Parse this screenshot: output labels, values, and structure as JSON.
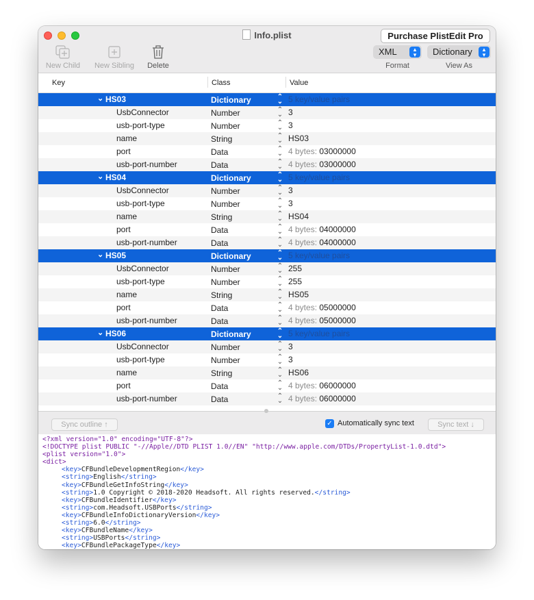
{
  "window": {
    "title": "Info.plist",
    "purchase_label": "Purchase PlistEdit Pro"
  },
  "toolbar": {
    "new_child": "New Child",
    "new_sibling": "New Sibling",
    "delete": "Delete",
    "format_value": "XML",
    "format_label": "Format",
    "view_as_value": "Dictionary",
    "view_as_label": "View As"
  },
  "columns": {
    "key": "Key",
    "class": "Class",
    "value": "Value"
  },
  "rows": [
    {
      "key": "HS03",
      "class": "Dictionary",
      "value": "",
      "hint": "5 key/value pairs",
      "group": true
    },
    {
      "key": "UsbConnector",
      "class": "Number",
      "value": "3",
      "hint": ""
    },
    {
      "key": "usb-port-type",
      "class": "Number",
      "value": "3",
      "hint": ""
    },
    {
      "key": "name",
      "class": "String",
      "value": "HS03",
      "hint": ""
    },
    {
      "key": "port",
      "class": "Data",
      "value": "03000000",
      "hint": "4 bytes:"
    },
    {
      "key": "usb-port-number",
      "class": "Data",
      "value": "03000000",
      "hint": "4 bytes:"
    },
    {
      "key": "HS04",
      "class": "Dictionary",
      "value": "",
      "hint": "5 key/value pairs",
      "group": true
    },
    {
      "key": "UsbConnector",
      "class": "Number",
      "value": "3",
      "hint": ""
    },
    {
      "key": "usb-port-type",
      "class": "Number",
      "value": "3",
      "hint": ""
    },
    {
      "key": "name",
      "class": "String",
      "value": "HS04",
      "hint": ""
    },
    {
      "key": "port",
      "class": "Data",
      "value": "04000000",
      "hint": "4 bytes:"
    },
    {
      "key": "usb-port-number",
      "class": "Data",
      "value": "04000000",
      "hint": "4 bytes:"
    },
    {
      "key": "HS05",
      "class": "Dictionary",
      "value": "",
      "hint": "5 key/value pairs",
      "group": true
    },
    {
      "key": "UsbConnector",
      "class": "Number",
      "value": "255",
      "hint": ""
    },
    {
      "key": "usb-port-type",
      "class": "Number",
      "value": "255",
      "hint": ""
    },
    {
      "key": "name",
      "class": "String",
      "value": "HS05",
      "hint": ""
    },
    {
      "key": "port",
      "class": "Data",
      "value": "05000000",
      "hint": "4 bytes:"
    },
    {
      "key": "usb-port-number",
      "class": "Data",
      "value": "05000000",
      "hint": "4 bytes:"
    },
    {
      "key": "HS06",
      "class": "Dictionary",
      "value": "",
      "hint": "5 key/value pairs",
      "group": true
    },
    {
      "key": "UsbConnector",
      "class": "Number",
      "value": "3",
      "hint": ""
    },
    {
      "key": "usb-port-type",
      "class": "Number",
      "value": "3",
      "hint": ""
    },
    {
      "key": "name",
      "class": "String",
      "value": "HS06",
      "hint": ""
    },
    {
      "key": "port",
      "class": "Data",
      "value": "06000000",
      "hint": "4 bytes:"
    },
    {
      "key": "usb-port-number",
      "class": "Data",
      "value": "06000000",
      "hint": "4 bytes:"
    }
  ],
  "sync": {
    "sync_outline": "Sync outline ↑",
    "auto_sync_label": "Automatically sync text",
    "auto_sync_checked": true,
    "sync_text": "Sync text ↓"
  },
  "xml_lines": [
    {
      "indent": 0,
      "parts": [
        {
          "c": "p",
          "t": "<?xml version=\"1.0\" encoding=\"UTF-8\"?>"
        }
      ]
    },
    {
      "indent": 0,
      "parts": [
        {
          "c": "p",
          "t": "<!DOCTYPE plist PUBLIC \"-//Apple//DTD PLIST 1.0//EN\" \"http://www.apple.com/DTDs/PropertyList-1.0.dtd\">"
        }
      ]
    },
    {
      "indent": 0,
      "parts": [
        {
          "c": "p",
          "t": "<plist version=\"1.0\">"
        }
      ]
    },
    {
      "indent": 0,
      "parts": [
        {
          "c": "p",
          "t": "<dict>"
        }
      ]
    },
    {
      "indent": 1,
      "parts": [
        {
          "c": "t",
          "t": "<key>"
        },
        {
          "c": "",
          "t": "CFBundleDevelopmentRegion"
        },
        {
          "c": "t",
          "t": "</key>"
        }
      ]
    },
    {
      "indent": 1,
      "parts": [
        {
          "c": "t",
          "t": "<string>"
        },
        {
          "c": "",
          "t": "English"
        },
        {
          "c": "t",
          "t": "</string>"
        }
      ]
    },
    {
      "indent": 1,
      "parts": [
        {
          "c": "t",
          "t": "<key>"
        },
        {
          "c": "",
          "t": "CFBundleGetInfoString"
        },
        {
          "c": "t",
          "t": "</key>"
        }
      ]
    },
    {
      "indent": 1,
      "parts": [
        {
          "c": "t",
          "t": "<string>"
        },
        {
          "c": "",
          "t": "1.0 Copyright © 2018-2020 Headsoft. All rights reserved."
        },
        {
          "c": "t",
          "t": "</string>"
        }
      ]
    },
    {
      "indent": 1,
      "parts": [
        {
          "c": "t",
          "t": "<key>"
        },
        {
          "c": "",
          "t": "CFBundleIdentifier"
        },
        {
          "c": "t",
          "t": "</key>"
        }
      ]
    },
    {
      "indent": 1,
      "parts": [
        {
          "c": "t",
          "t": "<string>"
        },
        {
          "c": "",
          "t": "com.Headsoft.USBPorts"
        },
        {
          "c": "t",
          "t": "</string>"
        }
      ]
    },
    {
      "indent": 1,
      "parts": [
        {
          "c": "t",
          "t": "<key>"
        },
        {
          "c": "",
          "t": "CFBundleInfoDictionaryVersion"
        },
        {
          "c": "t",
          "t": "</key>"
        }
      ]
    },
    {
      "indent": 1,
      "parts": [
        {
          "c": "t",
          "t": "<string>"
        },
        {
          "c": "",
          "t": "6.0"
        },
        {
          "c": "t",
          "t": "</string>"
        }
      ]
    },
    {
      "indent": 1,
      "parts": [
        {
          "c": "t",
          "t": "<key>"
        },
        {
          "c": "",
          "t": "CFBundleName"
        },
        {
          "c": "t",
          "t": "</key>"
        }
      ]
    },
    {
      "indent": 1,
      "parts": [
        {
          "c": "t",
          "t": "<string>"
        },
        {
          "c": "",
          "t": "USBPorts"
        },
        {
          "c": "t",
          "t": "</string>"
        }
      ]
    },
    {
      "indent": 1,
      "parts": [
        {
          "c": "t",
          "t": "<key>"
        },
        {
          "c": "",
          "t": "CFBundlePackageType"
        },
        {
          "c": "t",
          "t": "</key>"
        }
      ]
    }
  ]
}
